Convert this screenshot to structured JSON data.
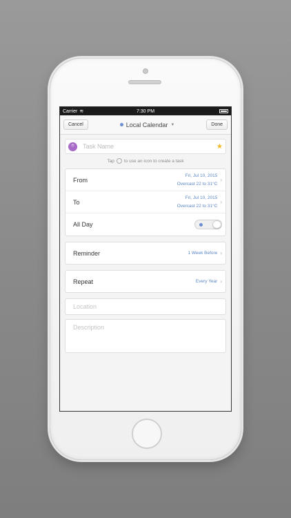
{
  "status": {
    "carrier": "Carrier",
    "time": "7:30 PM"
  },
  "nav": {
    "cancel": "Cancel",
    "title": "Local Calendar",
    "done": "Done",
    "accent": "#6d8fd0"
  },
  "task": {
    "placeholder": "Task Name",
    "icon": "task-icon",
    "star": "star-icon"
  },
  "hint": {
    "before": "Tap",
    "after": "to use an icon to create a task"
  },
  "schedule": {
    "from": {
      "label": "From",
      "date": "Fri, Jul 10, 2015",
      "weather": "Overcast  22 to 31°C"
    },
    "to": {
      "label": "To",
      "date": "Fri, Jul 10, 2015",
      "weather": "Overcast  22 to 31°C"
    },
    "allday": {
      "label": "All Day"
    }
  },
  "reminder": {
    "label": "Reminder",
    "value": "1 Week Before"
  },
  "repeat": {
    "label": "Repeat",
    "value": "Every Year"
  },
  "location": {
    "placeholder": "Location"
  },
  "description": {
    "placeholder": "Description"
  }
}
